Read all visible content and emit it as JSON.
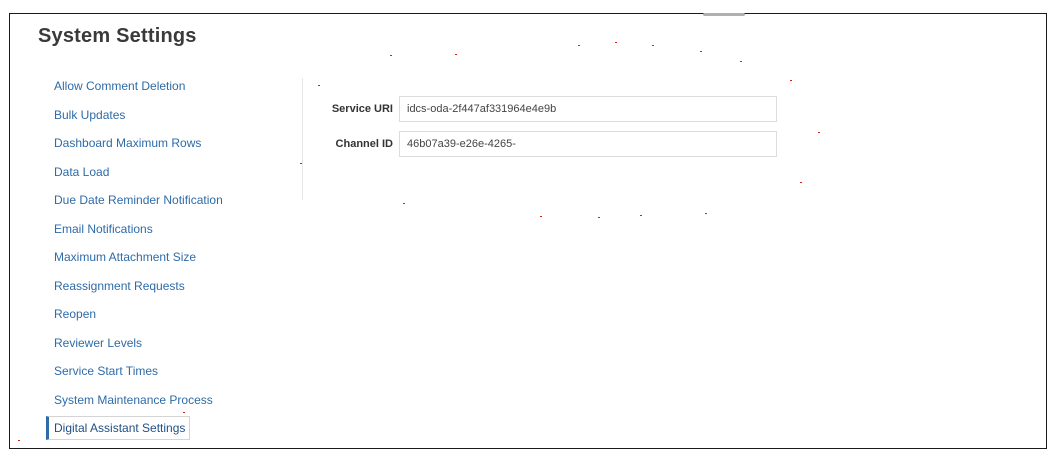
{
  "header": {
    "title": "System Settings"
  },
  "sidebar": {
    "items": [
      {
        "label": "Allow Comment Deletion"
      },
      {
        "label": "Bulk Updates"
      },
      {
        "label": "Dashboard Maximum Rows"
      },
      {
        "label": "Data Load"
      },
      {
        "label": "Due Date Reminder Notification"
      },
      {
        "label": "Email Notifications"
      },
      {
        "label": "Maximum Attachment Size"
      },
      {
        "label": "Reassignment Requests"
      },
      {
        "label": "Reopen"
      },
      {
        "label": "Reviewer Levels"
      },
      {
        "label": "Service Start Times"
      },
      {
        "label": "System Maintenance Process"
      },
      {
        "label": "Digital Assistant Settings",
        "selected": true
      }
    ]
  },
  "form": {
    "service_uri": {
      "label": "Service URI",
      "value": "idcs-oda-2f447af331964e4e9b"
    },
    "channel_id": {
      "label": "Channel ID",
      "value": "46b07a39-e26e-4265-"
    }
  },
  "colors": {
    "link": "#2e6ba8",
    "title": "#3a3a3a",
    "label": "#333333"
  }
}
